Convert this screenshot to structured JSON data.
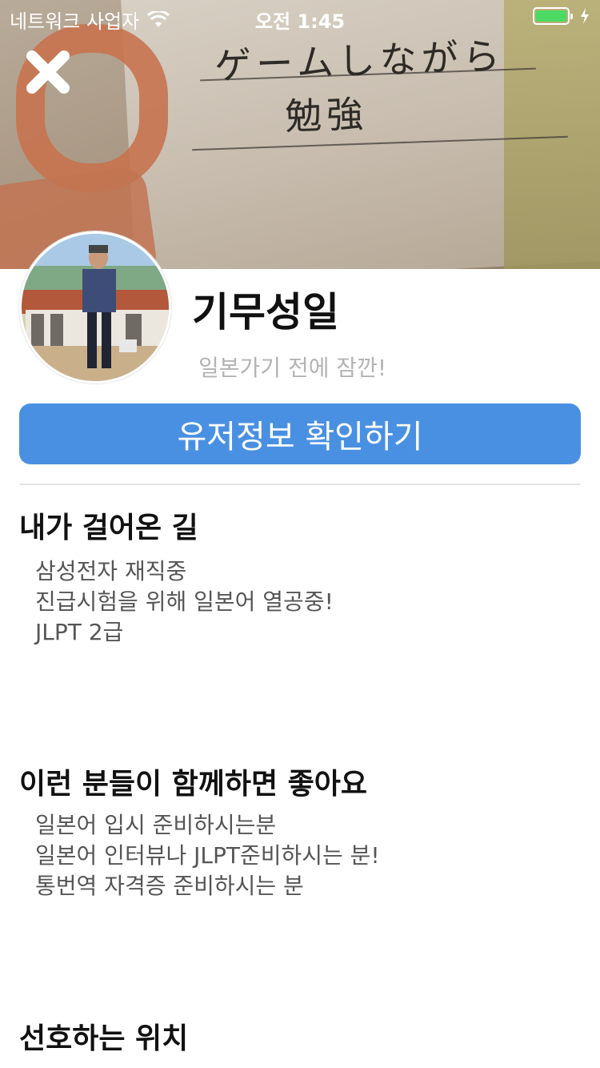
{
  "status_bar": {
    "carrier": "네트워크 사업자",
    "time": "오전 1:45",
    "battery_level": 1.0,
    "battery_color": "#4cd964"
  },
  "cover": {
    "handwritten_line1": "ゲームしながら",
    "handwritten_line2": "勉強"
  },
  "header": {
    "close_icon": "close-icon"
  },
  "profile": {
    "name": "기무성일",
    "status_message": "일본가기 전에 잠깐!"
  },
  "actions": {
    "user_info_label": "유저정보 확인하기",
    "accent_color": "#4a90e2"
  },
  "sections": [
    {
      "title": "내가 걸어온 길",
      "lines": [
        "삼성전자 재직중",
        "진급시험을 위해 일본어 열공중!",
        "JLPT 2급"
      ]
    },
    {
      "title": "이런 분들이 함께하면 좋아요",
      "lines": [
        "일본어 입시 준비하시는분",
        "일본어 인터뷰나 JLPT준비하시는 분!",
        "통번역 자격증 준비하시는 분"
      ]
    },
    {
      "title": "선호하는 위치",
      "lines": []
    }
  ]
}
